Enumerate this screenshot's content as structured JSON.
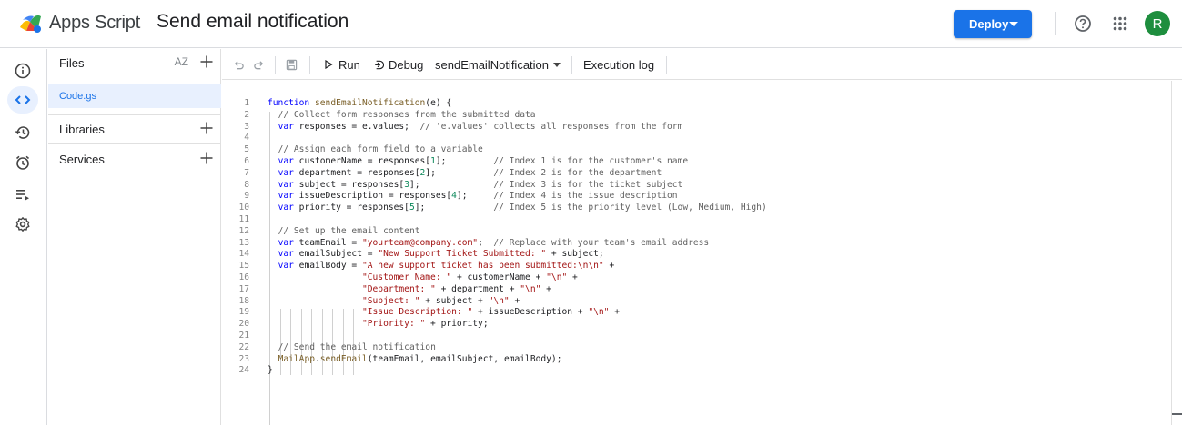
{
  "header": {
    "app_name": "Apps Script",
    "project_title": "Send email notification",
    "deploy_label": "Deploy",
    "avatar_letter": "R",
    "icons": [
      "apps-script-logo",
      "help-icon",
      "apps-grid-icon"
    ]
  },
  "rail": {
    "items": [
      "overview-icon",
      "editor-icon",
      "triggers-history-icon",
      "triggers-icon",
      "executions-icon",
      "settings-icon"
    ],
    "active": "editor-icon"
  },
  "files_panel": {
    "files_label": "Files",
    "sort_label": "AZ",
    "file_name": "Code.gs",
    "libraries_label": "Libraries",
    "services_label": "Services"
  },
  "toolbar": {
    "run_label": "Run",
    "debug_label": "Debug",
    "function_select": "sendEmailNotification",
    "execution_log_label": "Execution log"
  },
  "editor": {
    "line_numbers": [
      "1",
      "2",
      "3",
      "4",
      "5",
      "6",
      "7",
      "8",
      "9",
      "10",
      "11",
      "12",
      "13",
      "14",
      "15",
      "16",
      "17",
      "18",
      "19",
      "20",
      "21",
      "22",
      "23",
      "24"
    ],
    "lines": [
      "function sendEmailNotification(e) {",
      "  // Collect form responses from the submitted data",
      "  var responses = e.values;  // 'e.values' collects all responses from the form",
      "",
      "  // Assign each form field to a variable",
      "  var customerName = responses[1];         // Index 1 is for the customer's name",
      "  var department = responses[2];           // Index 2 is for the department",
      "  var subject = responses[3];              // Index 3 is for the ticket subject",
      "  var issueDescription = responses[4];     // Index 4 is the issue description",
      "  var priority = responses[5];             // Index 5 is the priority level (Low, Medium, High)",
      "",
      "  // Set up the email content",
      "  var teamEmail = \"yourteam@company.com\";  // Replace with your team's email address",
      "  var emailSubject = \"New Support Ticket Submitted: \" + subject;",
      "  var emailBody = \"A new support ticket has been submitted:\\n\\n\" +",
      "                  \"Customer Name: \" + customerName + \"\\n\" +",
      "                  \"Department: \" + department + \"\\n\" +",
      "                  \"Subject: \" + subject + \"\\n\" +",
      "                  \"Issue Description: \" + issueDescription + \"\\n\" +",
      "                  \"Priority: \" + priority;",
      "",
      "  // Send the email notification",
      "  MailApp.sendEmail(teamEmail, emailSubject, emailBody);",
      "}"
    ]
  }
}
